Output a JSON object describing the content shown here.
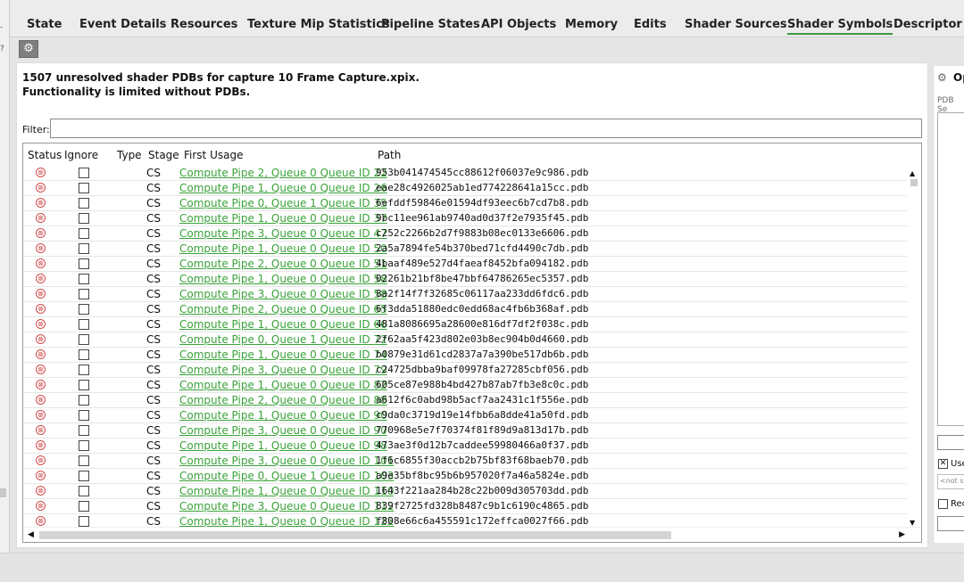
{
  "left_strip": {
    "marks": [
      "-",
      "?"
    ]
  },
  "tabs": [
    {
      "label": "State"
    },
    {
      "label": "Event Details"
    },
    {
      "label": "Resources"
    },
    {
      "label": "Texture Mip Statistics"
    },
    {
      "label": "Pipeline States"
    },
    {
      "label": "API Objects"
    },
    {
      "label": "Memory"
    },
    {
      "label": "Edits"
    },
    {
      "label": "Shader Sources"
    },
    {
      "label": "Shader Symbols"
    },
    {
      "label": "Descriptor Hea"
    }
  ],
  "active_tab": "Shader Symbols",
  "accent_color": "#3c9a3c",
  "error_color": "#d34b4b",
  "toolbar": {
    "settings_icon": "gear-icon",
    "settings_glyph": "⚙"
  },
  "warning": {
    "line1": "1507 unresolved shader PDBs for capture 10 Frame Capture.xpix.",
    "line2": "Functionality is limited without PDBs."
  },
  "filter": {
    "label": "Filter:",
    "value": ""
  },
  "table": {
    "columns": [
      "Status",
      "Ignore",
      "Type",
      "Stage",
      "First Usage",
      "Path"
    ],
    "rows": [
      {
        "status": "⊗",
        "stage": "CS",
        "usage": "Compute Pipe 2, Queue 0 Queue ID 22",
        "path": "953b041474545cc88612f06037e9c986.pdb"
      },
      {
        "status": "⊗",
        "stage": "CS",
        "usage": "Compute Pipe 1, Queue 0 Queue ID 26",
        "path": "eae28c4926025ab1ed774228641a15cc.pdb"
      },
      {
        "status": "⊗",
        "stage": "CS",
        "usage": "Compute Pipe 0, Queue 1 Queue ID 35",
        "path": "6efddf59846e01594df93eec6b7cd7b8.pdb"
      },
      {
        "status": "⊗",
        "stage": "CS",
        "usage": "Compute Pipe 1, Queue 0 Queue ID 37",
        "path": "9bc11ee961ab9740ad0d37f2e7935f45.pdb"
      },
      {
        "status": "⊗",
        "stage": "CS",
        "usage": "Compute Pipe 3, Queue 0 Queue ID 47",
        "path": "c252c2266b2d7f9883b08ec0133e6606.pdb"
      },
      {
        "status": "⊗",
        "stage": "CS",
        "usage": "Compute Pipe 1, Queue 0 Queue ID 50",
        "path": "2a5a7894fe54b370bed71cfd4490c7db.pdb"
      },
      {
        "status": "⊗",
        "stage": "CS",
        "usage": "Compute Pipe 2, Queue 0 Queue ID 51",
        "path": "4baaf489e527d4faeaf8452bfa094182.pdb"
      },
      {
        "status": "⊗",
        "stage": "CS",
        "usage": "Compute Pipe 1, Queue 0 Queue ID 58",
        "path": "02261b21bf8be47bbf64786265ec5357.pdb"
      },
      {
        "status": "⊗",
        "stage": "CS",
        "usage": "Compute Pipe 3, Queue 0 Queue ID 58",
        "path": "8a2f14f7f32685c06117aa233dd6fdc6.pdb"
      },
      {
        "status": "⊗",
        "stage": "CS",
        "usage": "Compute Pipe 2, Queue 0 Queue ID 65",
        "path": "6f3dda51880edc0edd68ac4fb6b368af.pdb"
      },
      {
        "status": "⊗",
        "stage": "CS",
        "usage": "Compute Pipe 1, Queue 0 Queue ID 66",
        "path": "481a8086695a28600e816df7df2f038c.pdb"
      },
      {
        "status": "⊗",
        "stage": "CS",
        "usage": "Compute Pipe 0, Queue 1 Queue ID 72",
        "path": "2f62aa5f423d802e03b8ec904b0d4660.pdb"
      },
      {
        "status": "⊗",
        "stage": "CS",
        "usage": "Compute Pipe 1, Queue 0 Queue ID 74",
        "path": "b0879e31d61cd2837a7a390be517db6b.pdb"
      },
      {
        "status": "⊗",
        "stage": "CS",
        "usage": "Compute Pipe 3, Queue 0 Queue ID 79",
        "path": "c24725dbba9baf09978fa27285cbf056.pdb"
      },
      {
        "status": "⊗",
        "stage": "CS",
        "usage": "Compute Pipe 1, Queue 0 Queue ID 82",
        "path": "605ce87e988b4bd427b87ab7fb3e8c0c.pdb"
      },
      {
        "status": "⊗",
        "stage": "CS",
        "usage": "Compute Pipe 2, Queue 0 Queue ID 88",
        "path": "a612f6c0abd98b5acf7aa2431c1f556e.pdb"
      },
      {
        "status": "⊗",
        "stage": "CS",
        "usage": "Compute Pipe 1, Queue 0 Queue ID 90",
        "path": "c9da0c3719d19e14fbb6a8dde41a50fd.pdb"
      },
      {
        "status": "⊗",
        "stage": "CS",
        "usage": "Compute Pipe 3, Queue 0 Queue ID 90",
        "path": "770968e5e7f70374f81f89d9a813d17b.pdb"
      },
      {
        "status": "⊗",
        "stage": "CS",
        "usage": "Compute Pipe 1, Queue 0 Queue ID 98",
        "path": "473ae3f0d12b7caddee59980466a0f37.pdb"
      },
      {
        "status": "⊗",
        "stage": "CS",
        "usage": "Compute Pipe 3, Queue 0 Queue ID 101",
        "path": "1f6c6855f30accb2b75bf83f68baeb70.pdb"
      },
      {
        "status": "⊗",
        "stage": "CS",
        "usage": "Compute Pipe 0, Queue 1 Queue ID 103",
        "path": "a9e35bf8bc95b6b957020f7a46a5824e.pdb"
      },
      {
        "status": "⊗",
        "stage": "CS",
        "usage": "Compute Pipe 1, Queue 0 Queue ID 110",
        "path": "1643f221aa284b28c22b009d305703dd.pdb"
      },
      {
        "status": "⊗",
        "stage": "CS",
        "usage": "Compute Pipe 3, Queue 0 Queue ID 112",
        "path": "839f2725fd328b8487c9b1c6190c4865.pdb"
      },
      {
        "status": "⊗",
        "stage": "CS",
        "usage": "Compute Pipe 1, Queue 0 Queue ID 122",
        "path": "f808e66c6a455591c172effca0027f66.pdb"
      }
    ]
  },
  "scroll": {
    "up": "▲",
    "down": "▼",
    "left": "◀",
    "right": "▶"
  },
  "right_panel": {
    "title": "Op",
    "sub": "PDB Se",
    "check1_label": "Use",
    "check1_mark": "✕",
    "placeholder": "<not s",
    "check2_label": "Rec"
  }
}
